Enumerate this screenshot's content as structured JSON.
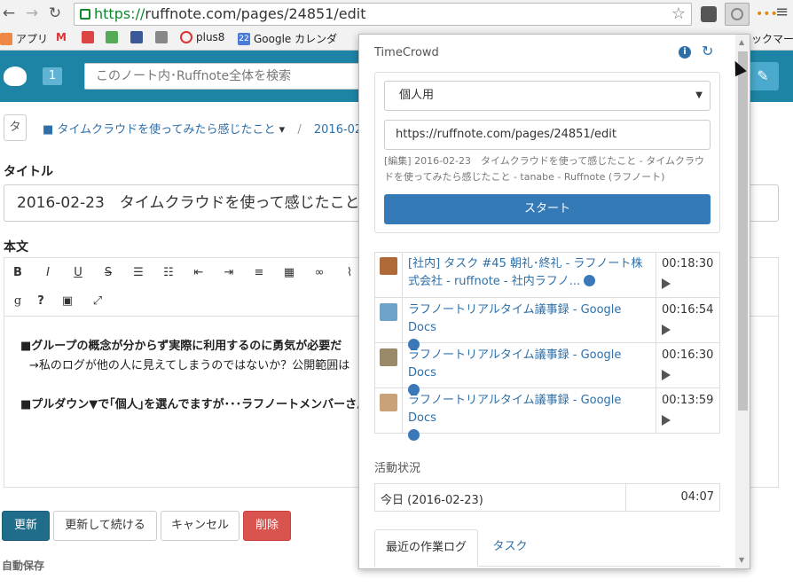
{
  "browser": {
    "url_scheme": "https://",
    "url_rest": "ruffnote.com/pages/24851/edit",
    "bookmarks": [
      {
        "label": "アプリ",
        "color": "#e84"
      },
      {
        "label": "",
        "color": "#d33"
      },
      {
        "label": "",
        "color": "#d44"
      },
      {
        "label": "",
        "color": "#5a5"
      },
      {
        "label": "",
        "color": "#3b5998"
      },
      {
        "label": "",
        "color": "#888"
      },
      {
        "label": "plus8",
        "color": "#d33"
      },
      {
        "label": "Google カレンダ",
        "color": "#4a7bd6"
      }
    ],
    "bookmarks_overflow": "ックマー"
  },
  "app": {
    "notify_count": "1",
    "search_placeholder": "このノート内･Ruffnote全体を検索",
    "note_icon_char": "タ",
    "breadcrumb_note": "タイムクラウドを使ってみたら感じたこと",
    "breadcrumb_sep": "/",
    "breadcrumb_page": "2016-02-",
    "title_label": "タイトル",
    "title_value": "2016-02-23　タイムクラウドを使って感じたこと",
    "body_label": "本文",
    "body_lines": [
      "■グループの概念が分からず実際に利用するのに勇気が必要だ",
      "→私のログが他の人に見えてしまうのではないか？公開範囲は",
      "",
      "■プルダウン▼で｢個人｣を選んでますが･･･ラフノートメンバーさん"
    ],
    "buttons": {
      "update": "更新",
      "update_continue": "更新して続ける",
      "cancel": "キャンセル",
      "delete": "削除"
    },
    "autosave_label": "自動保存"
  },
  "popup": {
    "app_name": "TimeCrowd",
    "team_select": "個人用",
    "url_field": "https://ruffnote.com/pages/24851/edit",
    "page_title_hint": "[編集] 2016-02-23　タイムクラウドを使って感じたこと - タイムクラウドを使ってみたら感じたこと - tanabe - Ruffnote (ラフノート)",
    "start_button": "スタート",
    "entries": [
      {
        "title": "[社内] タスク #45 朝礼･終礼 - ラフノート株式会社 - ruffnote - 社内ラフノ...",
        "time": "00:18:30",
        "avatar_color": "#b06a3a"
      },
      {
        "title": "ラフノートリアルタイム議事録 - Google Docs",
        "time": "00:16:54",
        "avatar_color": "#6fa3c7"
      },
      {
        "title": "ラフノートリアルタイム議事録 - Google Docs",
        "time": "00:16:30",
        "avatar_color": "#9b8a6a"
      },
      {
        "title": "ラフノートリアルタイム議事録 - Google Docs",
        "time": "00:13:59",
        "avatar_color": "#c9a27a"
      }
    ],
    "activity_heading": "活動状況",
    "today_label": "今日 (2016-02-23)",
    "today_time": "04:07",
    "tabs": [
      "最近の作業ログ",
      "タスク"
    ]
  }
}
